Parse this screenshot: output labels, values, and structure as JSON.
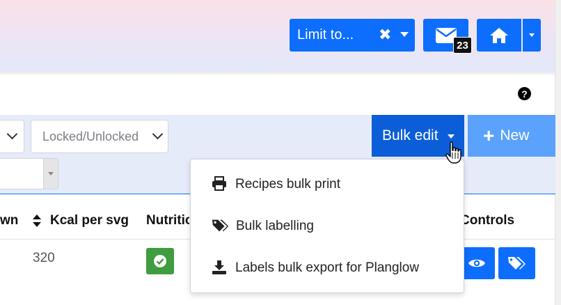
{
  "header": {
    "limit_label": "Limit to...",
    "clear_glyph": "✖",
    "mail_badge": "23"
  },
  "help": {
    "glyph": "?"
  },
  "filters": {
    "locked_select_placeholder": "Locked/Unlocked"
  },
  "toolbar": {
    "bulk_edit_label": "Bulk edit",
    "new_label": "New",
    "new_plus": "+"
  },
  "bulk_menu": {
    "items": [
      {
        "label": "Recipes bulk print",
        "icon": "print-icon"
      },
      {
        "label": "Bulk labelling",
        "icon": "tags-icon"
      },
      {
        "label": "Labels bulk export for Planglow",
        "icon": "download-icon"
      }
    ]
  },
  "table": {
    "headers": [
      "wn",
      "Kcal per svg",
      "Nutritio",
      "Controls"
    ],
    "rows": [
      {
        "kcal": "320"
      }
    ]
  },
  "colors": {
    "primary": "#0d6efd",
    "bulk_edit": "#0b5ed7",
    "new_button": "#5aa2fb",
    "success": "#3f9c3f",
    "filter_band": "#e6ebfa"
  }
}
